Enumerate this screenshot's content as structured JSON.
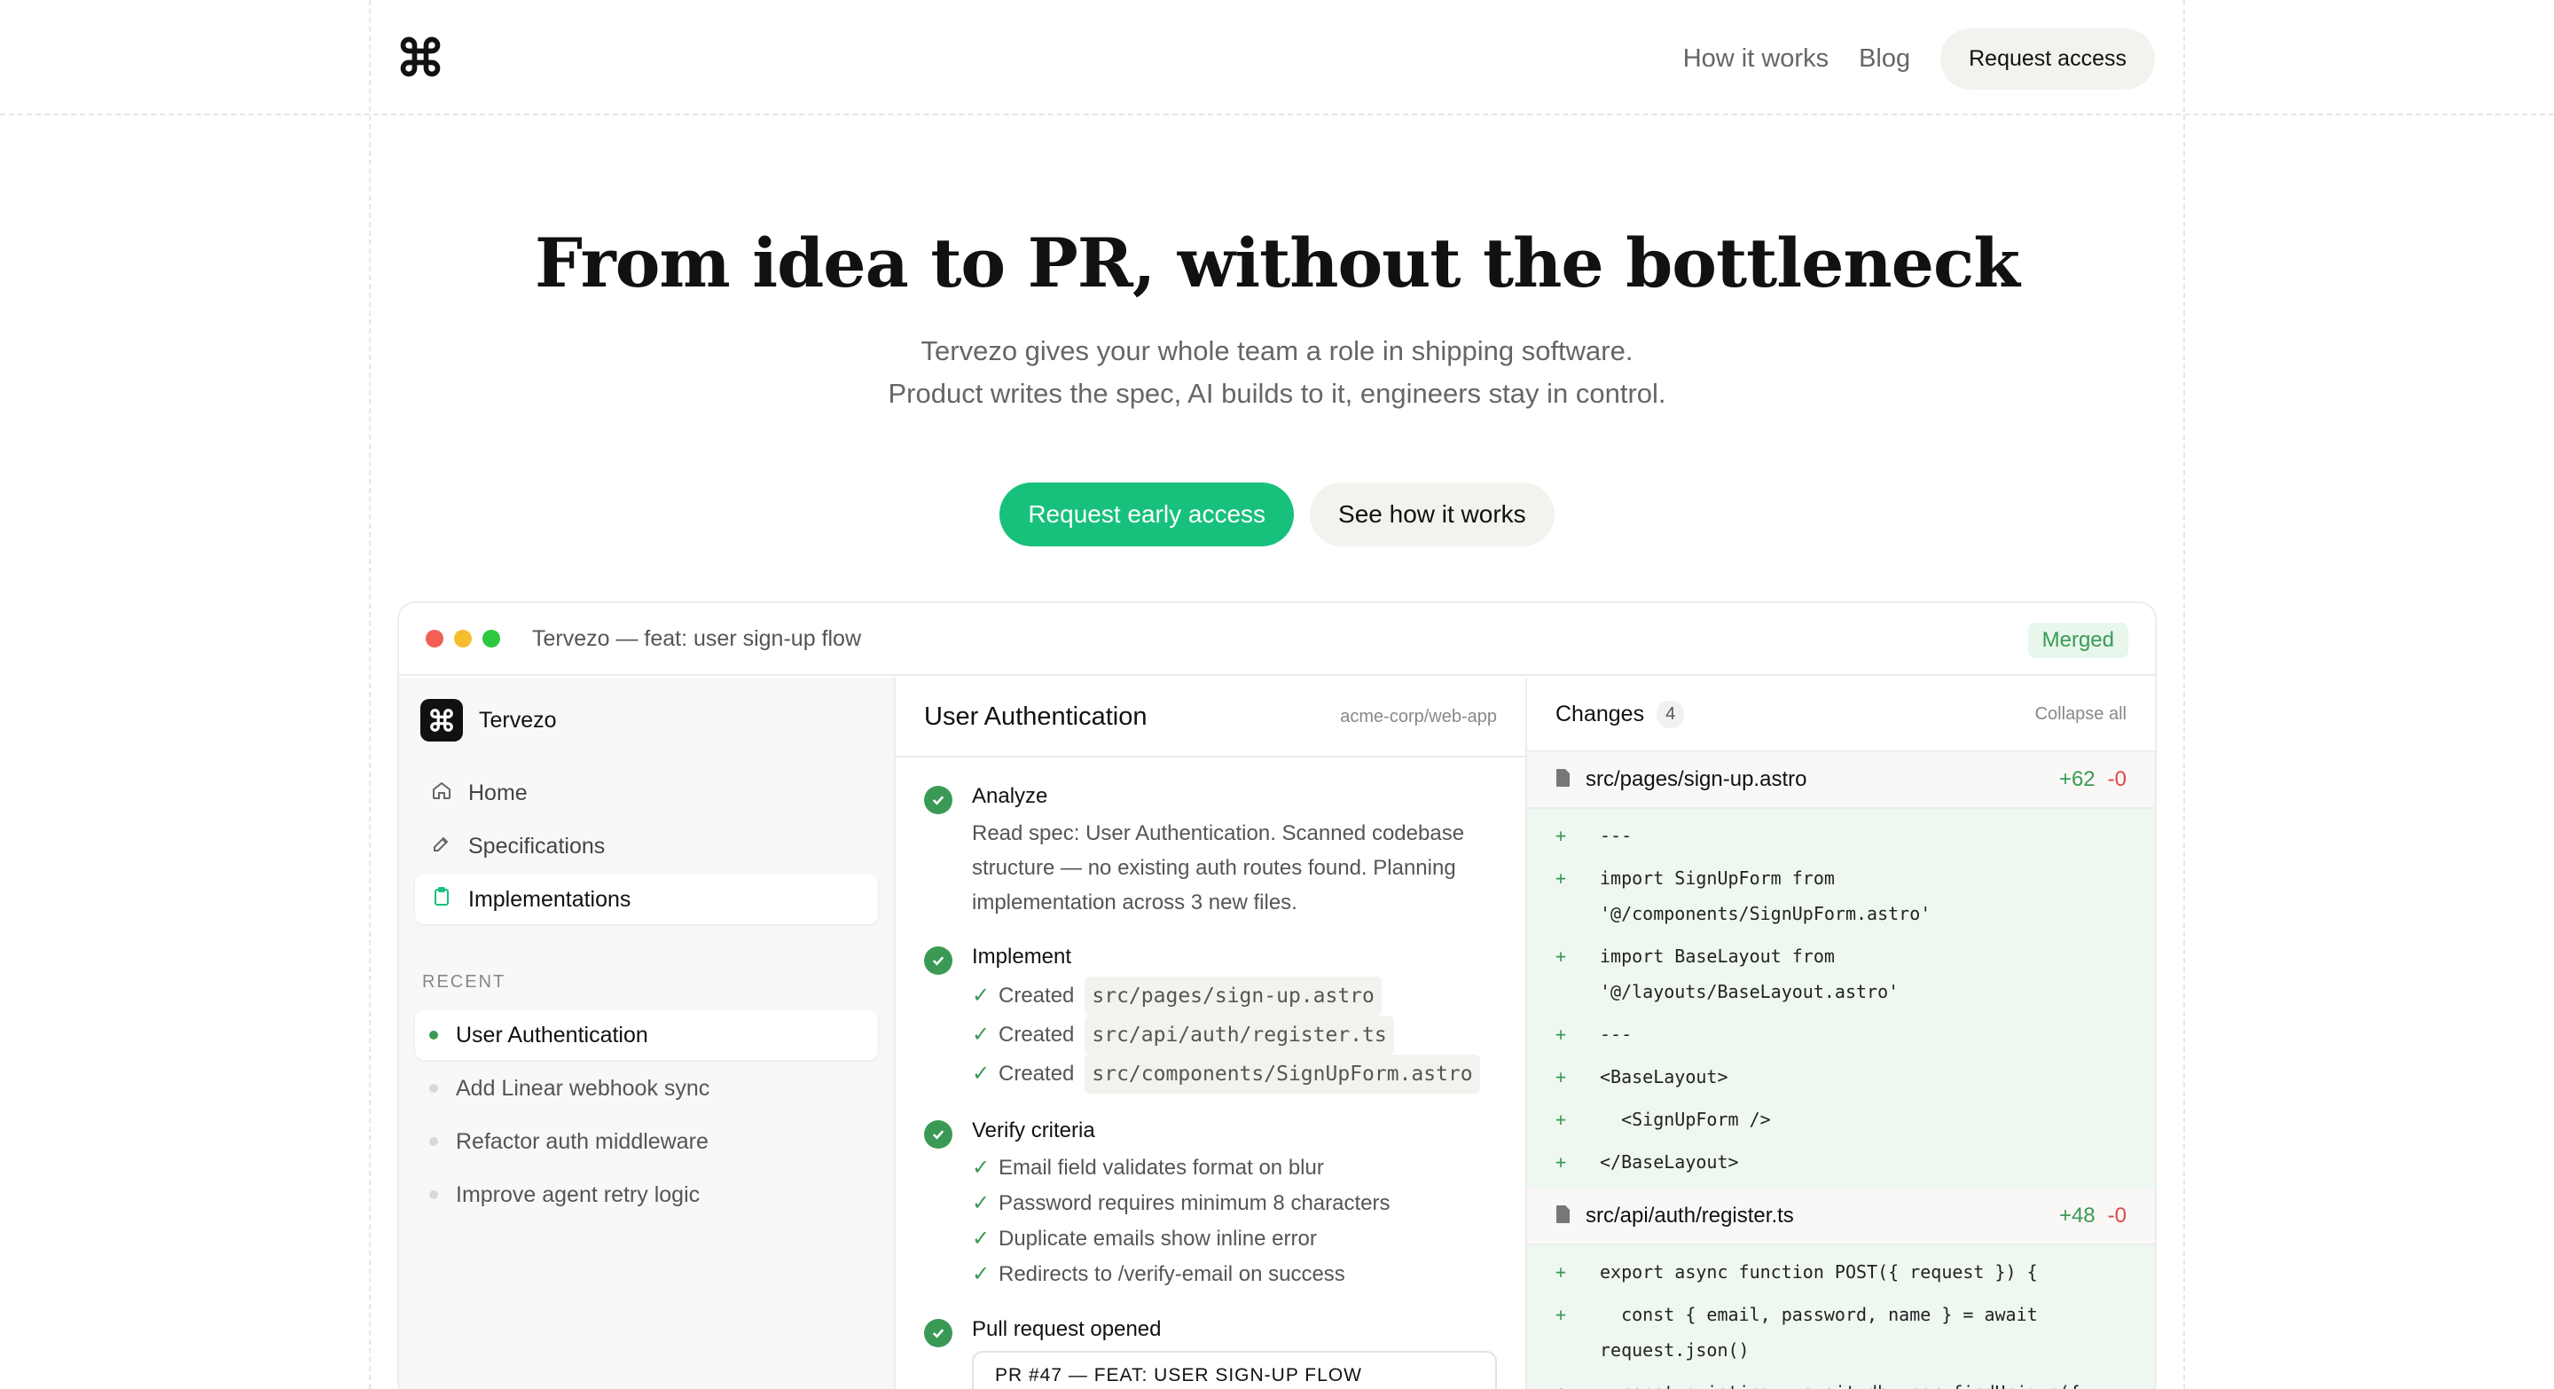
{
  "header": {
    "nav": [
      "How it works",
      "Blog"
    ],
    "cta": "Request access"
  },
  "hero": {
    "title": "From idea to PR, without the bottleneck",
    "subtitle_line1": "Tervezo gives your whole team a role in shipping software.",
    "subtitle_line2": "Product writes the spec, AI builds to it, engineers stay in control.",
    "primary_cta": "Request early access",
    "secondary_cta": "See how it works"
  },
  "window": {
    "title": "Tervezo — feat: user sign-up flow",
    "status": "Merged"
  },
  "sidebar": {
    "brand": "Tervezo",
    "nav": [
      {
        "label": "Home",
        "icon": "home-icon"
      },
      {
        "label": "Specifications",
        "icon": "edit-icon"
      },
      {
        "label": "Implementations",
        "icon": "clipboard-icon"
      }
    ],
    "recent_label": "RECENT",
    "recent": [
      "User Authentication",
      "Add Linear webhook sync",
      "Refactor auth middleware",
      "Improve agent retry logic"
    ]
  },
  "middle": {
    "title": "User Authentication",
    "repo": "acme-corp/web-app",
    "steps": [
      {
        "title": "Analyze",
        "desc": [
          "Read spec: User Authentication. Scanned codebase",
          "structure — no existing auth routes found. Planning",
          "implementation across 3 new files."
        ]
      },
      {
        "title": "Implement",
        "created_label": "Created",
        "files": [
          "src/pages/sign-up.astro",
          "src/api/auth/register.ts",
          "src/components/SignUpForm.astro"
        ]
      },
      {
        "title": "Verify criteria",
        "items": [
          "Email field validates format on blur",
          "Password requires minimum 8 characters",
          "Duplicate emails show inline error",
          "Redirects to /verify-email on success"
        ]
      },
      {
        "title": "Pull request opened",
        "pr": "PR #47 — FEAT: USER SIGN-UP FLOW"
      }
    ]
  },
  "changes": {
    "title": "Changes",
    "count": "4",
    "collapse": "Collapse all",
    "files": [
      {
        "name": "src/pages/sign-up.astro",
        "adds": "+62",
        "dels": "-0",
        "lines": [
          "---",
          "import SignUpForm from",
          "'@/components/SignUpForm.astro'",
          "import BaseLayout from",
          "'@/layouts/BaseLayout.astro'",
          "---",
          "<BaseLayout>",
          "  <SignUpForm />",
          "</BaseLayout>"
        ]
      },
      {
        "name": "src/api/auth/register.ts",
        "adds": "+48",
        "dels": "-0",
        "lines": [
          "export async function POST({ request }) {",
          "  const { email, password, name } = await",
          "request.json()",
          "  const existing = await db.user.findUnique({"
        ]
      }
    ]
  },
  "colors": {
    "accent": "#17c17b",
    "success": "#3a9a55",
    "danger": "#d94a4a"
  }
}
